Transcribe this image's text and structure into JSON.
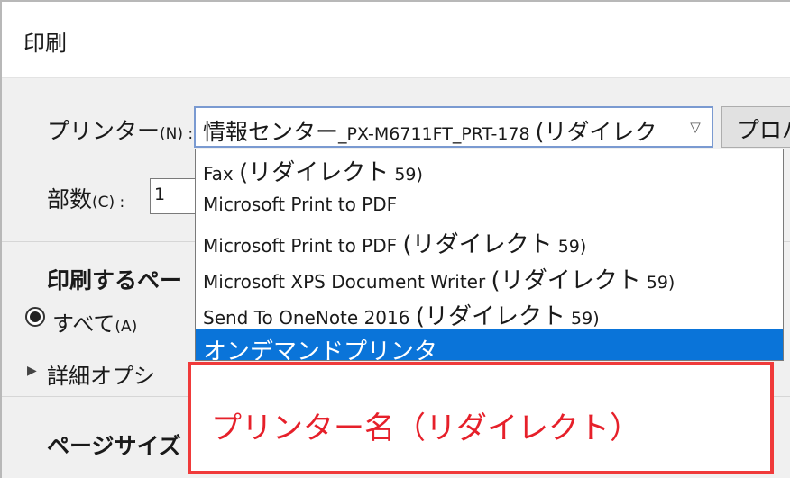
{
  "dialog": {
    "title": "印刷"
  },
  "printer": {
    "label": "プリンター",
    "accel": "(N) :",
    "selected_main": "情報センター",
    "selected_sub": "_PX-M6711FT_PRT-178 ",
    "selected_tail": "(リダイレク",
    "arrow_icon": "chevron-down-icon",
    "properties_label": "プロパ"
  },
  "copies": {
    "label": "部数",
    "accel": "(C) :",
    "value": "1"
  },
  "pages_section": {
    "heading": "印刷するペー",
    "all_label": "すべて",
    "all_accel": "(A)",
    "advanced_label": "詳細オプシ"
  },
  "page_size": {
    "heading": "ページサイズ"
  },
  "printer_options": [
    {
      "name": "Fax ",
      "suffix_jp": "(リダイレクト",
      "suffix_num": " 59)"
    },
    {
      "name": "Microsoft Print to PDF",
      "suffix_jp": "",
      "suffix_num": ""
    },
    {
      "name": "Microsoft Print to PDF ",
      "suffix_jp": "(リダイレクト",
      "suffix_num": " 59)"
    },
    {
      "name": "Microsoft XPS Document Writer ",
      "suffix_jp": "(リダイレクト",
      "suffix_num": " 59)"
    },
    {
      "name": "Send To OneNote 2016 ",
      "suffix_jp": "(リダイレクト",
      "suffix_num": " 59)"
    },
    {
      "name": "",
      "suffix_jp": "オンデマンドプリンタ",
      "suffix_num": ""
    }
  ],
  "callout": {
    "text": "プリンター名（リダイレクト）"
  },
  "colors": {
    "selection": "#0a74d9",
    "callout_border": "#f03a3a",
    "callout_text": "#e6202a"
  }
}
